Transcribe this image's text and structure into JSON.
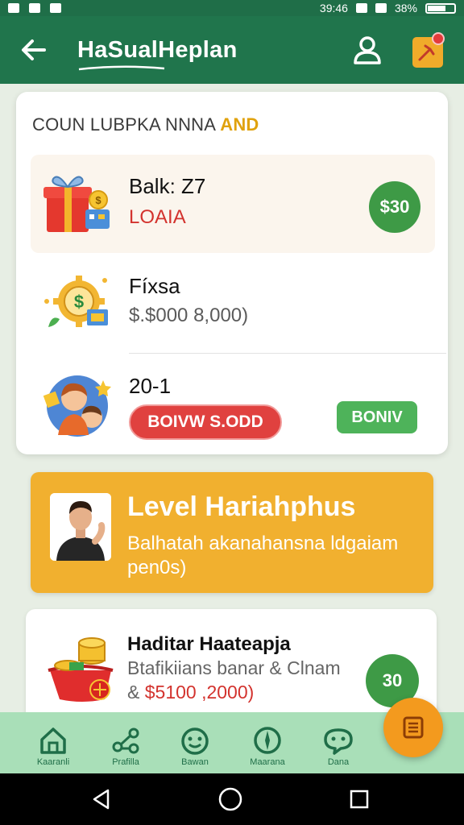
{
  "status_bar": {
    "time": "39:46",
    "battery": "38%"
  },
  "app_bar": {
    "title": "HaSualHeplan"
  },
  "offers": {
    "heading": "COUN LUBPKA NNNA",
    "heading_accent": "AND",
    "items": [
      {
        "title": "Balk: Z7",
        "subtitle": "LOAIA",
        "badge": "$30",
        "icon": "gift-box-icon"
      },
      {
        "title": "Fíxsa",
        "subtitle": "$.$000 8,000)",
        "icon": "gear-dollar-icon"
      },
      {
        "title": "20-1",
        "pill_label": "BOIVW S.ODD",
        "button_label": "BONIV",
        "icon": "family-icon"
      }
    ]
  },
  "level_banner": {
    "title": "Level Hariahphus",
    "description": "Balhatah akanahansna ldgaiam pen0s)"
  },
  "reward": {
    "title": "Haditar Haateapja",
    "line1": "Btafikiians banar & Clnam",
    "line2_prefix": "& ",
    "line2_value": "$5100 ,2000)",
    "badge": "30",
    "icon": "coins-bag-icon"
  },
  "bottom_nav": {
    "items": [
      {
        "label": "Kaaranli",
        "icon": "home-icon"
      },
      {
        "label": "Prafilla",
        "icon": "share-icon"
      },
      {
        "label": "Bawan",
        "icon": "face-icon"
      },
      {
        "label": "Maarana",
        "icon": "compass-icon"
      },
      {
        "label": "Dana",
        "icon": "chat-icon"
      }
    ]
  },
  "colors": {
    "primary": "#20754c",
    "accent": "#f1b02f",
    "badge_green": "#3e9a46",
    "pill_red": "#e0413f",
    "fab": "#f39a1e"
  }
}
